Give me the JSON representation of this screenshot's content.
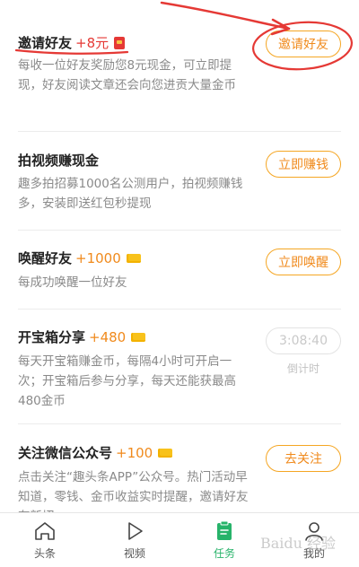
{
  "tasks": [
    {
      "title": "邀请好友",
      "reward": "+8元",
      "desc": "每收一位好友奖励您8元现金，可立即提现，好友阅读文章还会向您进贡大量金币",
      "button": "邀请好友"
    },
    {
      "title": "拍视频赚现金",
      "desc": "趣多拍招募1000名公测用户，拍视频赚钱多，安装即送红包秒提现",
      "button": "立即赚钱"
    },
    {
      "title": "唤醒好友",
      "reward": "+1000",
      "desc": "每成功唤醒一位好友",
      "button": "立即唤醒"
    },
    {
      "title": "开宝箱分享",
      "reward": "+480",
      "desc": "每天开宝箱赚金币，每隔4小时可开启一次；开宝箱后参与分享，每天还能获最高480金币",
      "button": "3:08:40",
      "button_sub": "倒计时"
    },
    {
      "title": "关注微信公众号",
      "reward": "+100",
      "desc": "点击关注“趣头条APP”公众号。热门活动早知道，零钱、金币收益实时提醒，邀请好友有新招",
      "button": "去关注"
    }
  ],
  "tabbar": [
    {
      "label": "头条",
      "icon": "home-icon"
    },
    {
      "label": "视频",
      "icon": "play-icon"
    },
    {
      "label": "任务",
      "icon": "task-icon",
      "active": true
    },
    {
      "label": "我的",
      "icon": "profile-icon"
    }
  ],
  "colors": {
    "accent": "#f5a623",
    "active_tab": "#27b36a",
    "annotation": "#e53935"
  },
  "watermark": "Baidu 经验"
}
